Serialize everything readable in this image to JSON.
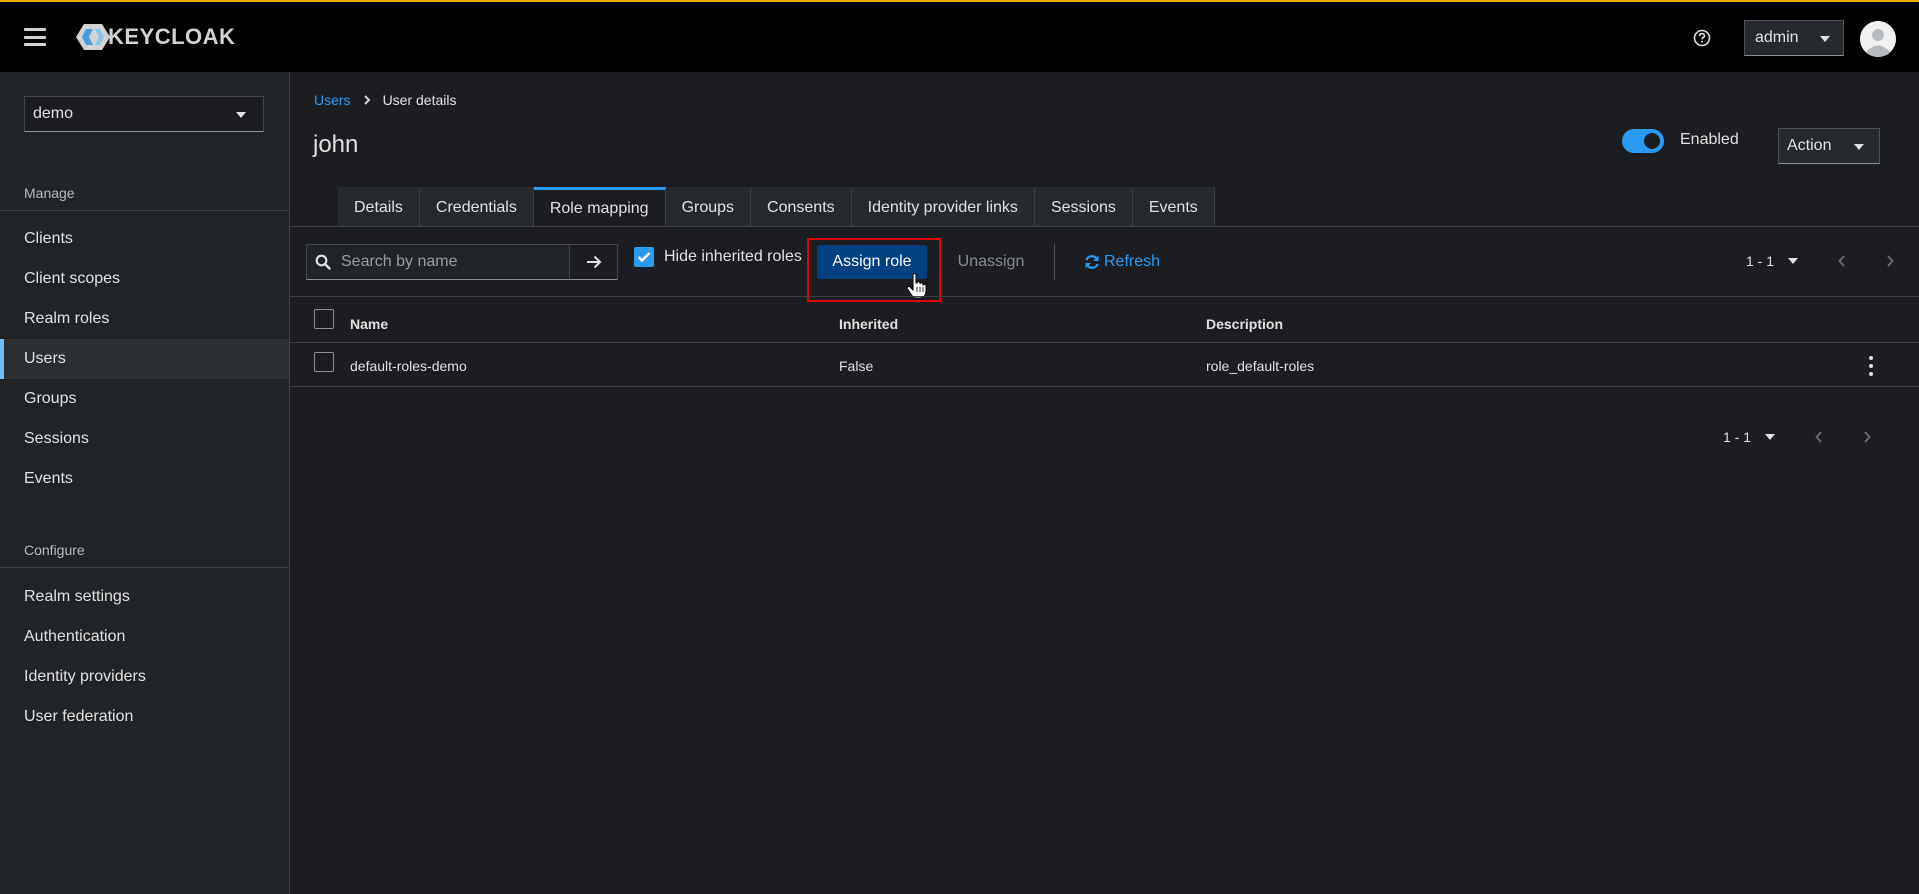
{
  "header": {
    "brand": "KEYCLOAK",
    "user_menu": "admin"
  },
  "sidebar": {
    "realm": "demo",
    "sections": [
      {
        "title": "Manage",
        "items": [
          "Clients",
          "Client scopes",
          "Realm roles",
          "Users",
          "Groups",
          "Sessions",
          "Events"
        ]
      },
      {
        "title": "Configure",
        "items": [
          "Realm settings",
          "Authentication",
          "Identity providers",
          "User federation"
        ]
      }
    ],
    "active_item": "Users"
  },
  "breadcrumb": {
    "parent": "Users",
    "current": "User details"
  },
  "page": {
    "title": "john",
    "enabled_label": "Enabled",
    "enabled": true,
    "action_label": "Action"
  },
  "tabs": [
    "Details",
    "Credentials",
    "Role mapping",
    "Groups",
    "Consents",
    "Identity provider links",
    "Sessions",
    "Events"
  ],
  "active_tab": "Role mapping",
  "toolbar": {
    "search_placeholder": "Search by name",
    "hide_inherited_label": "Hide inherited roles",
    "hide_inherited_checked": true,
    "assign_label": "Assign role",
    "unassign_label": "Unassign",
    "refresh_label": "Refresh",
    "pagination": "1 - 1"
  },
  "table": {
    "columns": [
      "Name",
      "Inherited",
      "Description"
    ],
    "rows": [
      {
        "name": "default-roles-demo",
        "inherited": "False",
        "description": "role_default-roles"
      }
    ]
  },
  "footer_pagination": "1 - 1",
  "colors": {
    "accent": "#2b9af3",
    "primary_button": "#004080",
    "masthead_border": "#f0ab00",
    "highlight": "#e00000"
  }
}
